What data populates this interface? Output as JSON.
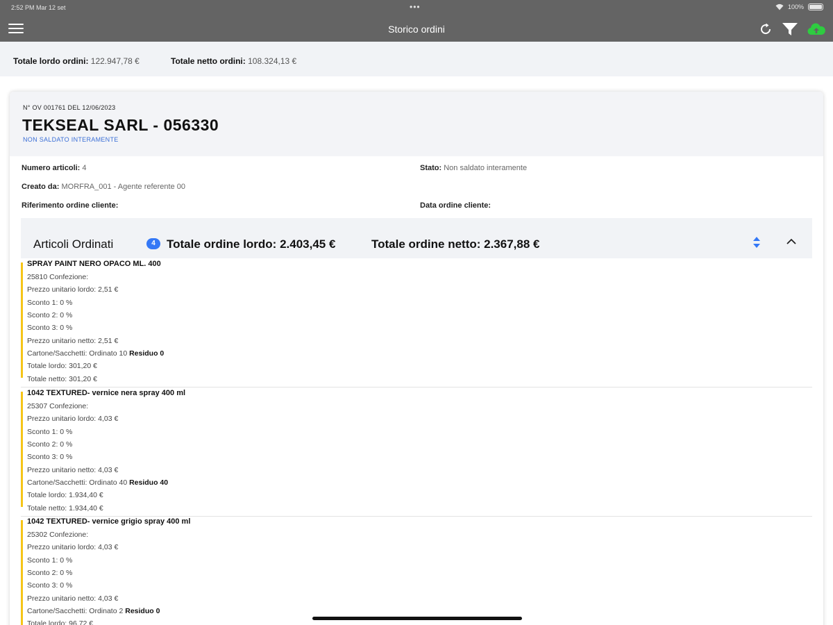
{
  "status": {
    "time": "2:52 PM   Mar 12 set",
    "battery": "100%"
  },
  "nav": {
    "title": "Storico ordini"
  },
  "totals": {
    "gross_label": "Totale lordo ordini:",
    "gross_value": "122.947,78 €",
    "net_label": "Totale netto ordini:",
    "net_value": "108.324,13 €"
  },
  "order": {
    "number": "N° OV 001761 DEL 12/06/2023",
    "client": "TEKSEAL SARL - 056330",
    "pay_status": "NON SALDATO INTERAMENTE",
    "fields": {
      "articles_label": "Numero articoli:",
      "articles_value": "4",
      "state_label": "Stato:",
      "state_value": "Non saldato interamente",
      "created_label": "Creato da:",
      "created_value": "MORFRA_001 - Agente referente 00",
      "ref_label": "Riferimento ordine cliente:",
      "date_label": "Data ordine cliente:"
    },
    "items_header": {
      "label": "Articoli Ordinati",
      "count": "4",
      "gross": "Totale ordine lordo: 2.403,45 €",
      "net": "Totale ordine netto: 2.367,88 €"
    },
    "items": [
      {
        "name": "SPRAY PAINT NERO OPACO ML. 400",
        "code": "25810 Confezione:",
        "unit_gross": "Prezzo unitario lordo: 2,51 €",
        "disc1": "Sconto 1: 0 %",
        "disc2": "Sconto 2: 0 %",
        "disc3": "Sconto 3: 0 %",
        "unit_net": "Prezzo unitario netto: 2,51 €",
        "ordered": "Cartone/Sacchetti: Ordinato 10",
        "residual": "Residuo 0",
        "total_gross": "Totale lordo: 301,20 €",
        "total_net": "Totale netto: 301,20 €"
      },
      {
        "name": "1042 TEXTURED- vernice nera spray 400 ml",
        "code": "25307 Confezione:",
        "unit_gross": "Prezzo unitario lordo: 4,03 €",
        "disc1": "Sconto 1: 0 %",
        "disc2": "Sconto 2: 0 %",
        "disc3": "Sconto 3: 0 %",
        "unit_net": "Prezzo unitario netto: 4,03 €",
        "ordered": "Cartone/Sacchetti: Ordinato 40",
        "residual": "Residuo 40",
        "total_gross": "Totale lordo: 1.934,40 €",
        "total_net": "Totale netto: 1.934,40 €"
      },
      {
        "name": "1042 TEXTURED- vernice grigio spray 400 ml",
        "code": "25302 Confezione:",
        "unit_gross": "Prezzo unitario lordo: 4,03 €",
        "disc1": "Sconto 1: 0 %",
        "disc2": "Sconto 2: 0 %",
        "disc3": "Sconto 3: 0 %",
        "unit_net": "Prezzo unitario netto: 4,03 €",
        "ordered": "Cartone/Sacchetti: Ordinato 2",
        "residual": "Residuo 0",
        "total_gross": "Totale lordo: 96,72 €",
        "total_net": ""
      }
    ]
  },
  "colors": {
    "nav_bg": "#646464",
    "accent": "#3478f6",
    "item_bar": "#f5c518",
    "cloud": "#2ecc40"
  }
}
